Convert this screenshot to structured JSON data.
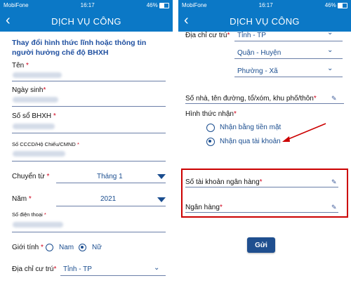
{
  "status": {
    "carrier": "MobiFone",
    "time": "16:17",
    "battery": "46%"
  },
  "nav": {
    "title": "DỊCH VỤ CÔNG",
    "back_glyph": "‹"
  },
  "left": {
    "heading": "Thay đổi hình thức lĩnh hoặc thông tin người hưởng chế độ BHXH",
    "fields": {
      "ten": "Tên",
      "ngay_sinh": "Ngày sinh",
      "so_so": "Số sổ BHXH",
      "cccd": "Số CCCD/Hộ Chiếu/CMND",
      "chuyen_tu": "Chuyển từ",
      "chuyen_tu_value": "Tháng 1",
      "nam": "Năm",
      "nam_value": "2021",
      "sdt": "Số điện thoại",
      "gioi_tinh": "Giới tính",
      "nam_gender": "Nam",
      "nu_gender": "Nữ",
      "dia_chi": "Địa chỉ cư trú",
      "tinh_value": "Tỉnh - TP"
    },
    "required_mark": "*"
  },
  "right": {
    "dia_chi": "Địa chỉ cư trú",
    "tinh_value": "Tỉnh - TP",
    "huyen_value": "Quận - Huyện",
    "xa_value": "Phường - Xã",
    "so_nha": "Số nhà, tên đường, tổ/xóm, khu phố/thôn",
    "hinh_thuc": "Hình thức nhận",
    "opt_tien_mat": "Nhận bằng tiền mặt",
    "opt_tai_khoan": "Nhận qua tài khoản",
    "so_tk": "Số tài khoản ngân hàng",
    "ngan_hang": "Ngân hàng",
    "submit": "Gửi",
    "required_mark": "*"
  },
  "colors": {
    "header": "#0b78c6",
    "accent": "#1a4d8f",
    "required": "#d0021b",
    "highlight": "#cc0000"
  }
}
